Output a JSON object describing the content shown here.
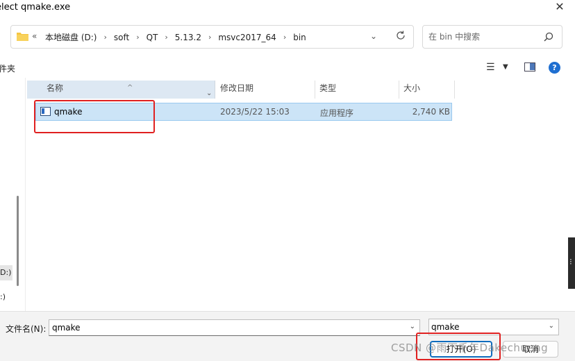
{
  "window": {
    "title": "elect qmake.exe"
  },
  "address": {
    "overflow": "«",
    "crumbs": [
      "本地磁盘 (D:)",
      "soft",
      "QT",
      "5.13.2",
      "msvc2017_64",
      "bin"
    ],
    "crumb_sep": "›"
  },
  "search": {
    "placeholder": "在 bin 中搜索"
  },
  "toolbar": {
    "new_folder_label": "件夹"
  },
  "nav": {
    "item1": "D:)",
    "item2": ":)"
  },
  "columns": {
    "name": "名称",
    "date": "修改日期",
    "type": "类型",
    "size": "大小"
  },
  "files": [
    {
      "name": "qmake",
      "date": "2023/5/22 15:03",
      "type": "应用程序",
      "size": "2,740 KB"
    }
  ],
  "bottom": {
    "filename_label": "文件名(N):",
    "filename_value": "qmake",
    "filter_value": "qmake",
    "open_label": "打开(O)",
    "cancel_label": "取消"
  },
  "watermark": "CSDN @雨下千年Dakechueng",
  "colors": {
    "selection": "#cce4f7",
    "accent": "#0f6cbd",
    "highlight_box": "#e02020"
  }
}
